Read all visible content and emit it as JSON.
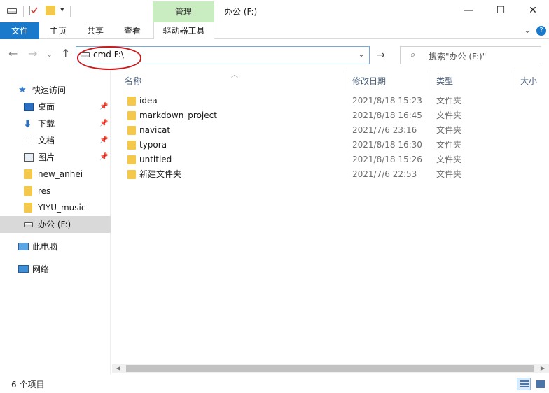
{
  "titlebar": {
    "manage_tab": "管理",
    "window_title": "办公 (F:)",
    "minimize_label": "—",
    "maximize_label": "☐",
    "close_label": "✕",
    "dropdown_label": "▾"
  },
  "ribbon": {
    "tabs": [
      {
        "label": "文件"
      },
      {
        "label": "主页"
      },
      {
        "label": "共享"
      },
      {
        "label": "查看"
      },
      {
        "label": "驱动器工具"
      }
    ],
    "expand_label": "⌄",
    "help_label": "?"
  },
  "navigation": {
    "back": "←",
    "forward": "→",
    "recent": "⌄",
    "up": "↑"
  },
  "address_bar": {
    "value": "cmd F:\\",
    "chevron": "⌄",
    "refresh": "→"
  },
  "search": {
    "icon": "⌕",
    "placeholder": "搜索\"办公 (F:)\""
  },
  "nav_pane": {
    "quick_access": "快速访问",
    "items": [
      {
        "label": "桌面",
        "pinned": "📌"
      },
      {
        "label": "下载",
        "pinned": "📌"
      },
      {
        "label": "文档",
        "pinned": "📌"
      },
      {
        "label": "图片",
        "pinned": "📌"
      },
      {
        "label": "new_anhei"
      },
      {
        "label": "res"
      },
      {
        "label": "YIYU_music"
      },
      {
        "label": "办公 (F:)"
      }
    ],
    "this_pc": "此电脑",
    "network": "网络"
  },
  "columns": {
    "name": "名称",
    "modified": "修改日期",
    "type": "类型",
    "size": "大小"
  },
  "files": [
    {
      "name": "idea",
      "modified": "2021/8/18 15:23",
      "type": "文件夹"
    },
    {
      "name": "markdown_project",
      "modified": "2021/8/18 16:45",
      "type": "文件夹"
    },
    {
      "name": "navicat",
      "modified": "2021/7/6 23:16",
      "type": "文件夹"
    },
    {
      "name": "typora",
      "modified": "2021/8/18 16:30",
      "type": "文件夹"
    },
    {
      "name": "untitled",
      "modified": "2021/8/18 15:26",
      "type": "文件夹"
    },
    {
      "name": "新建文件夹",
      "modified": "2021/7/6 22:53",
      "type": "文件夹"
    }
  ],
  "status": {
    "count": "6 个项目"
  },
  "colors": {
    "file_tab": "#1979ca",
    "manage_tab": "#c9ecc0",
    "folder": "#f4c84a",
    "selected_nav": "#d9d9d9",
    "annotation": "#cc1a1a"
  }
}
